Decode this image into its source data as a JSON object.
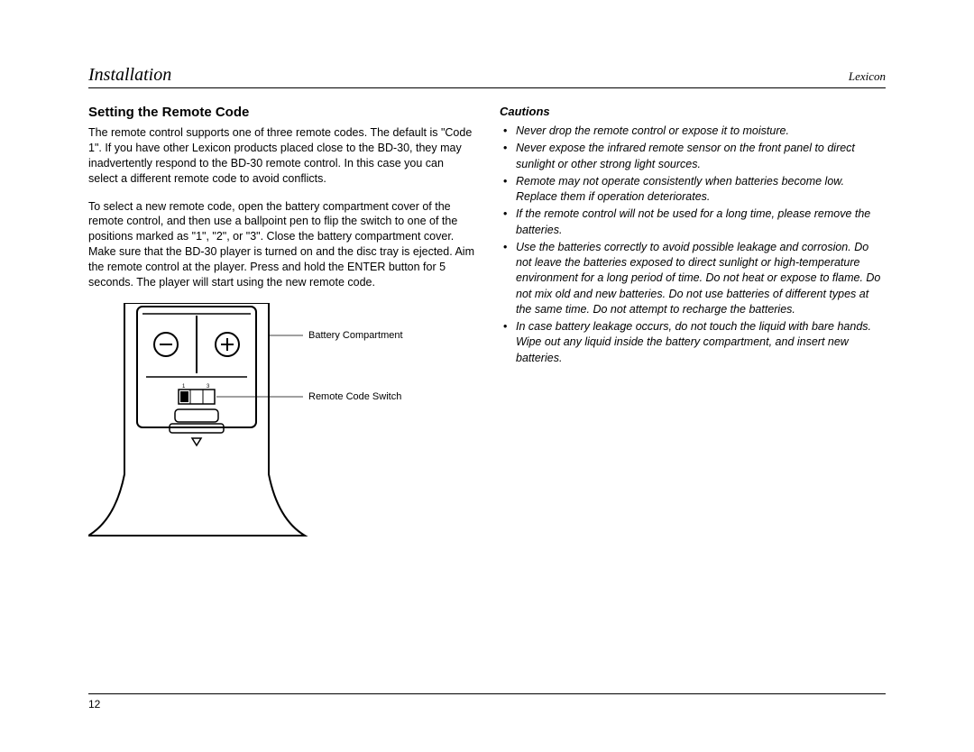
{
  "header": {
    "section": "Installation",
    "brand": "Lexicon"
  },
  "left": {
    "heading": "Setting the Remote Code",
    "para1": "The remote control supports one of three remote codes. The default is \"Code 1\". If you have other Lexicon products placed close to the BD-30, they may inadvertently respond to the BD-30 remote control. In this case you can select a different remote code to avoid conflicts.",
    "para2": "To select a new remote code, open the battery compartment cover of the remote control, and then use a ballpoint pen to flip the switch to one of the positions marked as \"1\", \"2\", or \"3\". Close the battery compartment cover. Make sure that the BD-30 player is turned on and the disc tray is ejected. Aim the remote control at the player. Press and hold the ENTER button for 5 seconds. The player will start using the new remote code.",
    "callout1": "Battery Compartment",
    "callout2": "Remote Code Switch"
  },
  "right": {
    "heading": "Cautions",
    "items": [
      "Never drop the remote control or expose it to moisture.",
      "Never expose the infrared remote sensor on the front panel to direct sunlight or other strong light sources.",
      "Remote may not operate consistently when batteries become low. Replace them if operation deteriorates.",
      "If the remote control will not be used for a long time, please remove the batteries.",
      "Use the batteries correctly to avoid possible leakage and corrosion. Do not leave the batteries exposed to direct sunlight or high-temperature environment for a long period of time. Do not heat or expose to flame. Do not mix old and new batteries. Do not use batteries of different types at the same time. Do not attempt to recharge the batteries.",
      "In case battery leakage occurs, do not touch the liquid with bare hands. Wipe out any liquid inside the battery compartment, and insert new batteries."
    ]
  },
  "pageNumber": "12"
}
